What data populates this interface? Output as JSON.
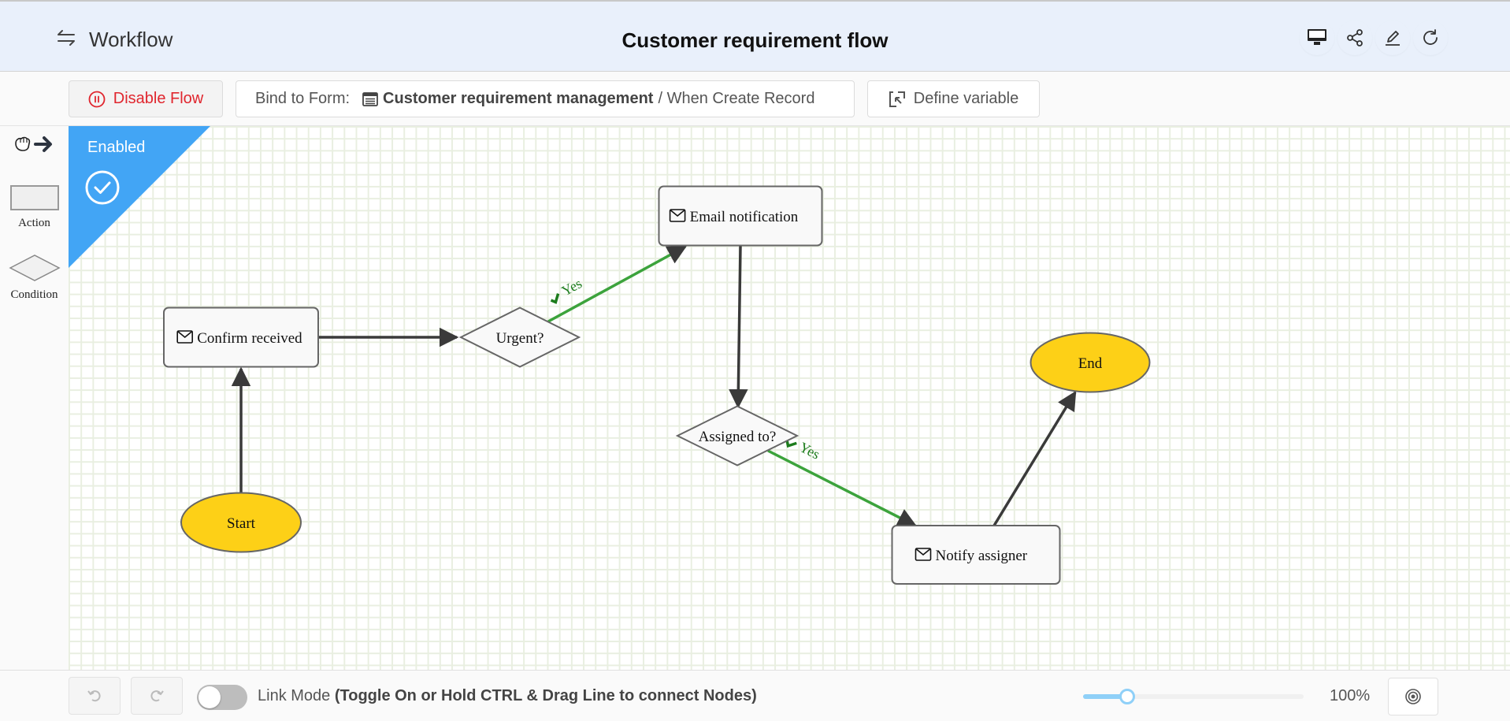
{
  "header": {
    "app_name": "Workflow",
    "title": "Customer requirement flow",
    "icons": [
      "desktop-icon",
      "share-icon",
      "edit-icon",
      "refresh-icon"
    ]
  },
  "toolbar": {
    "disable_label": "Disable Flow",
    "bind_prefix": "Bind to Form:",
    "bind_form_name": "Customer requirement management",
    "bind_suffix": "/ When Create Record",
    "define_label": "Define variable"
  },
  "palette": {
    "action_label": "Action",
    "condition_label": "Condition"
  },
  "status": {
    "label": "Enabled",
    "color": "#42a5f5"
  },
  "flow": {
    "nodes": [
      {
        "id": "start",
        "type": "start",
        "label": "Start"
      },
      {
        "id": "confirm",
        "type": "action",
        "label": "Confirm received",
        "icon": "mail-icon"
      },
      {
        "id": "urgent",
        "type": "condition",
        "label": "Urgent?"
      },
      {
        "id": "email",
        "type": "action",
        "label": "Email notification",
        "icon": "mail-icon"
      },
      {
        "id": "assigned",
        "type": "condition",
        "label": "Assigned to?"
      },
      {
        "id": "notify",
        "type": "action",
        "label": "Notify assigner",
        "icon": "mail-icon"
      },
      {
        "id": "end",
        "type": "end",
        "label": "End"
      }
    ],
    "edges": [
      {
        "from": "start",
        "to": "confirm",
        "label": ""
      },
      {
        "from": "confirm",
        "to": "urgent",
        "label": ""
      },
      {
        "from": "urgent",
        "to": "email",
        "label": "Yes",
        "condition": true
      },
      {
        "from": "email",
        "to": "assigned",
        "label": ""
      },
      {
        "from": "assigned",
        "to": "notify",
        "label": "Yes",
        "condition": true
      },
      {
        "from": "notify",
        "to": "end",
        "label": ""
      }
    ],
    "colors": {
      "terminal_fill": "#fdd017",
      "node_fill": "#f9f9f9",
      "node_stroke": "#666666",
      "edge": "#3a3a3a",
      "condition_edge": "#3ca33c"
    }
  },
  "bottom": {
    "link_mode_label": "Link Mode",
    "link_mode_hint": "(Toggle On or Hold CTRL & Drag Line to connect Nodes)",
    "link_mode_on": false,
    "zoom_percent": "100%",
    "zoom_slider_fraction": 0.2
  }
}
